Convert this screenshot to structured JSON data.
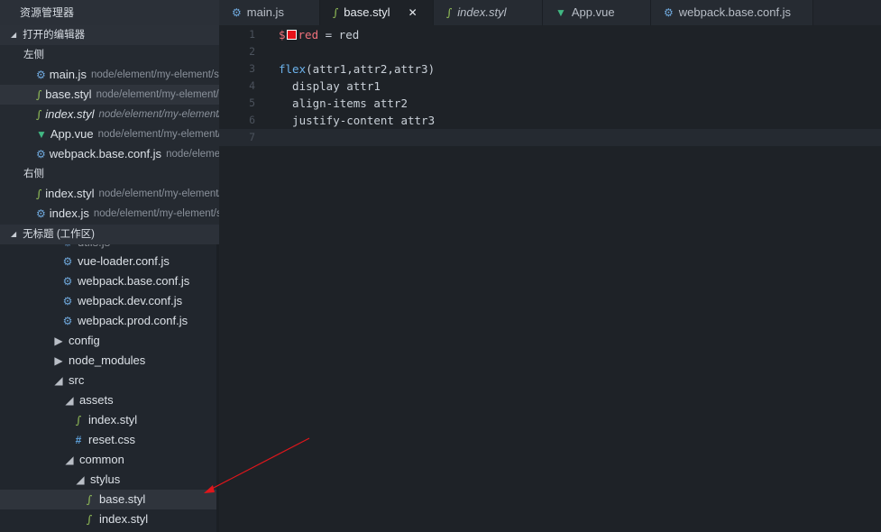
{
  "explorer": {
    "title": "资源管理器",
    "open_editors_label": "打开的编辑器",
    "left_group_label": "左侧",
    "right_group_label": "右侧",
    "left_group": [
      {
        "icon": "gear-icon",
        "name": "main.js",
        "path": "node/element/my-element/src"
      },
      {
        "icon": "stylus-icon",
        "name": "base.styl",
        "path": "node/element/my-element/src"
      },
      {
        "icon": "stylus-icon",
        "name": "index.styl",
        "path": "node/element/my-element/src"
      },
      {
        "icon": "vue-icon",
        "name": "App.vue",
        "path": "node/element/my-element/src"
      },
      {
        "icon": "gear-icon",
        "name": "webpack.base.conf.js",
        "path": "node/element/my-element/build"
      }
    ],
    "right_group": [
      {
        "icon": "stylus-icon",
        "name": "index.styl",
        "path": "node/element/my-element/src"
      },
      {
        "icon": "gear-icon",
        "name": "index.js",
        "path": "node/element/my-element/src"
      }
    ],
    "workspace_label": "无标题 (工作区)",
    "tree": [
      {
        "name": "utils.js",
        "icon": "gear-icon"
      },
      {
        "name": "vue-loader.conf.js",
        "icon": "gear-icon"
      },
      {
        "name": "webpack.base.conf.js",
        "icon": "gear-icon"
      },
      {
        "name": "webpack.dev.conf.js",
        "icon": "gear-icon"
      },
      {
        "name": "webpack.prod.conf.js",
        "icon": "gear-icon"
      },
      {
        "name": "config",
        "icon": "chevron-right-icon"
      },
      {
        "name": "node_modules",
        "icon": "chevron-right-icon"
      },
      {
        "name": "src",
        "icon": "chevron-down-icon"
      },
      {
        "name": "assets",
        "icon": "chevron-down-icon"
      },
      {
        "name": "index.styl",
        "icon": "stylus-icon"
      },
      {
        "name": "reset.css",
        "icon": "hash-icon"
      },
      {
        "name": "common",
        "icon": "chevron-down-icon"
      },
      {
        "name": "stylus",
        "icon": "chevron-down-icon"
      },
      {
        "name": "base.styl",
        "icon": "stylus-icon"
      },
      {
        "name": "index.styl",
        "icon": "stylus-icon"
      }
    ]
  },
  "tabs": [
    {
      "label": "main.js",
      "icon": "gear-icon"
    },
    {
      "label": "base.styl",
      "icon": "stylus-icon",
      "close": "✕"
    },
    {
      "label": "index.styl",
      "icon": "stylus-icon"
    },
    {
      "label": "App.vue",
      "icon": "vue-icon"
    },
    {
      "label": "webpack.base.conf.js",
      "icon": "gear-icon"
    }
  ],
  "editor": {
    "lines": [
      {
        "n": "1",
        "t1": "$",
        "t2": "red",
        "t3": " = red"
      },
      {
        "n": "2",
        "text": ""
      },
      {
        "n": "3",
        "kw": "flex",
        "text": "(attr1,attr2,attr3)"
      },
      {
        "n": "4",
        "text": "  display attr1"
      },
      {
        "n": "5",
        "text": "  align-items attr2"
      },
      {
        "n": "6",
        "text": "  justify-content attr3"
      },
      {
        "n": "7",
        "text": ""
      }
    ],
    "swatch_color": "#e8121a"
  },
  "colors": {
    "accent_arrow": "#e0161b",
    "stylus": "#98c65a",
    "js": "#6fa8dc",
    "vue": "#41b883"
  }
}
